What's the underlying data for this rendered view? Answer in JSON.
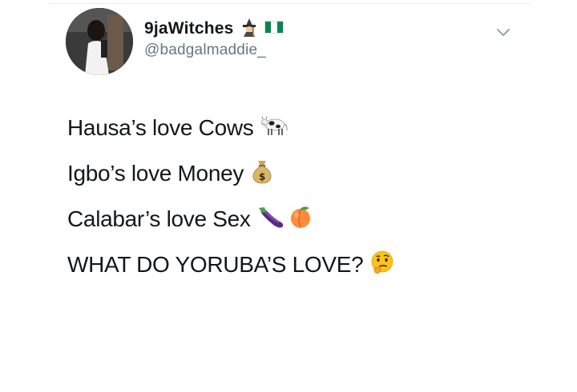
{
  "tweet": {
    "display_name": "9jaWitches",
    "handle": "@badgalmaddie_",
    "lines": [
      "Hausa’s love Cows",
      "Igbo’s love Money",
      "Calabar’s love Sex",
      "WHAT DO YORUBA’S LOVE?"
    ],
    "badge_icons": [
      "witch-icon",
      "nigeria-flag-icon"
    ],
    "line_icons": [
      "cow-icon",
      "money-bag-icon",
      "eggplant-icon peach-icon",
      "thinking-face-icon"
    ]
  },
  "colors": {
    "text": "#14171a",
    "handle": "#657786",
    "divider": "#e6ecf0",
    "flag_green": "#008751"
  }
}
